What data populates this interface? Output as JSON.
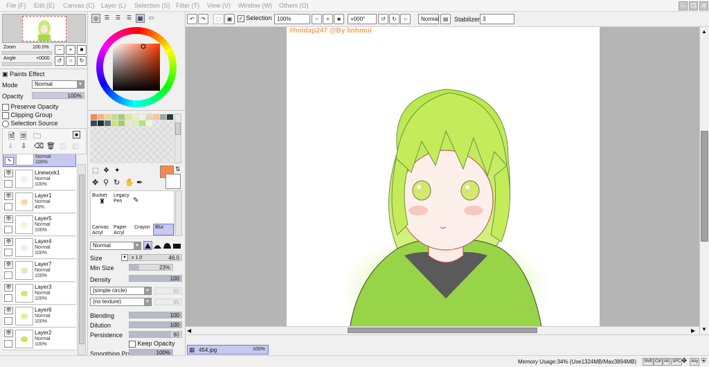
{
  "menubar": {
    "items": [
      "File (F)",
      "Edit (E)",
      "Canvas (C)",
      "Layer (L)",
      "Selection (S)",
      "Filter (T)",
      "View (V)",
      "Window (W)",
      "Others (O)"
    ]
  },
  "navigator": {
    "zoom_label": "Zoom",
    "zoom_value": "100.0%",
    "angle_label": "Angle",
    "angle_value": "+0000"
  },
  "layer_panel": {
    "paint_effect_label": "Paints Effect",
    "mode_label": "Mode",
    "mode_value": "Normal",
    "opacity_label": "Opacity",
    "opacity_value": "100%",
    "preserve_opacity": "Preserve Opacity",
    "clipping_group": "Clipping Group",
    "selection_source": "Selection Source",
    "top_partial": {
      "mode": "Normal",
      "opacity": "100%"
    },
    "layers": [
      {
        "name": "Linework1",
        "mode": "Normal",
        "opacity": "100%"
      },
      {
        "name": "Layer1",
        "mode": "Normal",
        "opacity": "49%"
      },
      {
        "name": "Layer5",
        "mode": "Normal",
        "opacity": "100%"
      },
      {
        "name": "Layer4",
        "mode": "Normal",
        "opacity": "100%"
      },
      {
        "name": "Layer7",
        "mode": "Normal",
        "opacity": "100%"
      },
      {
        "name": "Layer3",
        "mode": "Normal",
        "opacity": "100%"
      },
      {
        "name": "Layer6",
        "mode": "Normal",
        "opacity": "100%"
      },
      {
        "name": "Layer2",
        "mode": "Normal",
        "opacity": "100%"
      }
    ]
  },
  "palette": {
    "swatches": [
      "#f08a5d",
      "#f5b38a",
      "#e8d890",
      "#c9d7a0",
      "#a8c97a",
      "#d6e8a8",
      "#e8f0c0",
      "#f0f0e0",
      "#e8d4b8",
      "#f5c6a0",
      "#9aa8a0",
      "#2a3a3a",
      "#3a4a50",
      "#1e2e38",
      "#5a7070",
      "#c8e878",
      "#a0d058",
      "#e8e8c8",
      "#d8f0b0",
      "#b8e080",
      "#f0f8e0"
    ]
  },
  "tools": {
    "row1": [
      "Bucket",
      "Legacy Pen"
    ],
    "row2": [
      "Canvas Acryl",
      "Paper Acryl",
      "Crayon",
      "Blur"
    ],
    "blend_mode": "Normal",
    "main_color": "#f58a50"
  },
  "brush": {
    "size_label": "Size",
    "size_mult": "x 1.0",
    "size_value": "46.0",
    "min_size_label": "Min Size",
    "min_size_value": "23%",
    "density_label": "Density",
    "density_value": "100",
    "shape": "(simple circle)",
    "shape_value": "50",
    "texture": "(no texture)",
    "texture_value": "95",
    "blending_label": "Blending",
    "blending_value": "100",
    "dilution_label": "Dilution",
    "dilution_value": "100",
    "persistence_label": "Persistence",
    "persistence_value": "80",
    "keep_opacity": "Keep Opacity",
    "smoothing_label": "Smoothing Prs",
    "smoothing_value": "100%"
  },
  "toolbar": {
    "selection_label": "Selection",
    "zoom_value": "100%",
    "angle_value": "+000°",
    "blend_value": "Normal",
    "stabilizer_label": "Stabilizer",
    "stabilizer_value": "3"
  },
  "canvas": {
    "watermark": "#hoidap247 @By linhmui"
  },
  "document_tab": {
    "name": "454.jpg",
    "zoom": "100%"
  },
  "status": {
    "memory": "Memory Usage:34% (Use1324MB/Max3894MB)",
    "keys": [
      "Shift",
      "Ctrl",
      "Alt",
      "SPC",
      "Any"
    ]
  }
}
